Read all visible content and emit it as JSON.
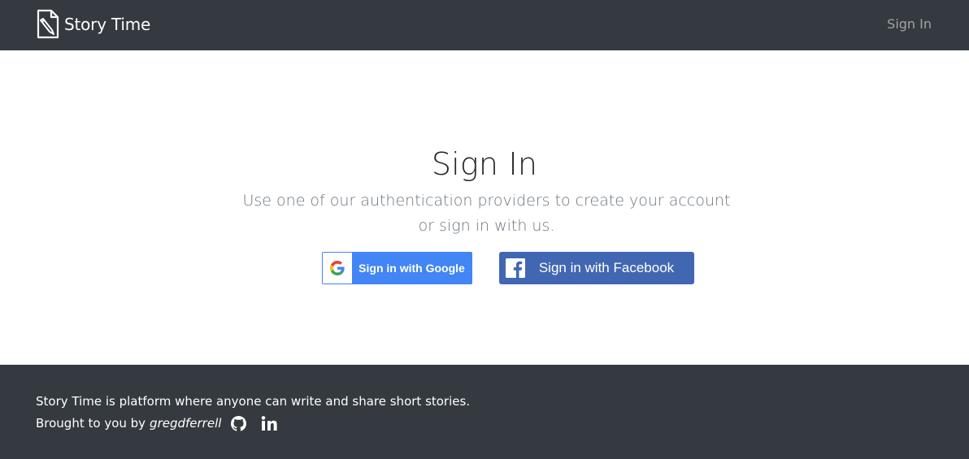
{
  "navbar": {
    "brand_icon": "pencil-document-icon",
    "brand_name": "Story Time",
    "signin_label": "Sign In"
  },
  "main": {
    "title": "Sign In",
    "subtitle": "Use one of our authentication providers to create your account or sign in with us.",
    "google_button": {
      "label": "Sign in with Google",
      "icon": "google-logo-icon"
    },
    "facebook_button": {
      "label": "Sign in with Facebook",
      "icon": "facebook-logo-icon"
    }
  },
  "footer": {
    "tagline": "Story Time is platform where anyone can write and share short stories.",
    "brought_by": "Brought to you by",
    "author": "gregdferrell",
    "social_icons": [
      "github-icon",
      "linkedin-icon"
    ]
  },
  "colors": {
    "navbar_bg": "#343a40",
    "footer_bg": "#343a40",
    "google_blue": "#4285f4",
    "facebook_blue": "#4267b2",
    "muted_text": "#6c757d"
  }
}
